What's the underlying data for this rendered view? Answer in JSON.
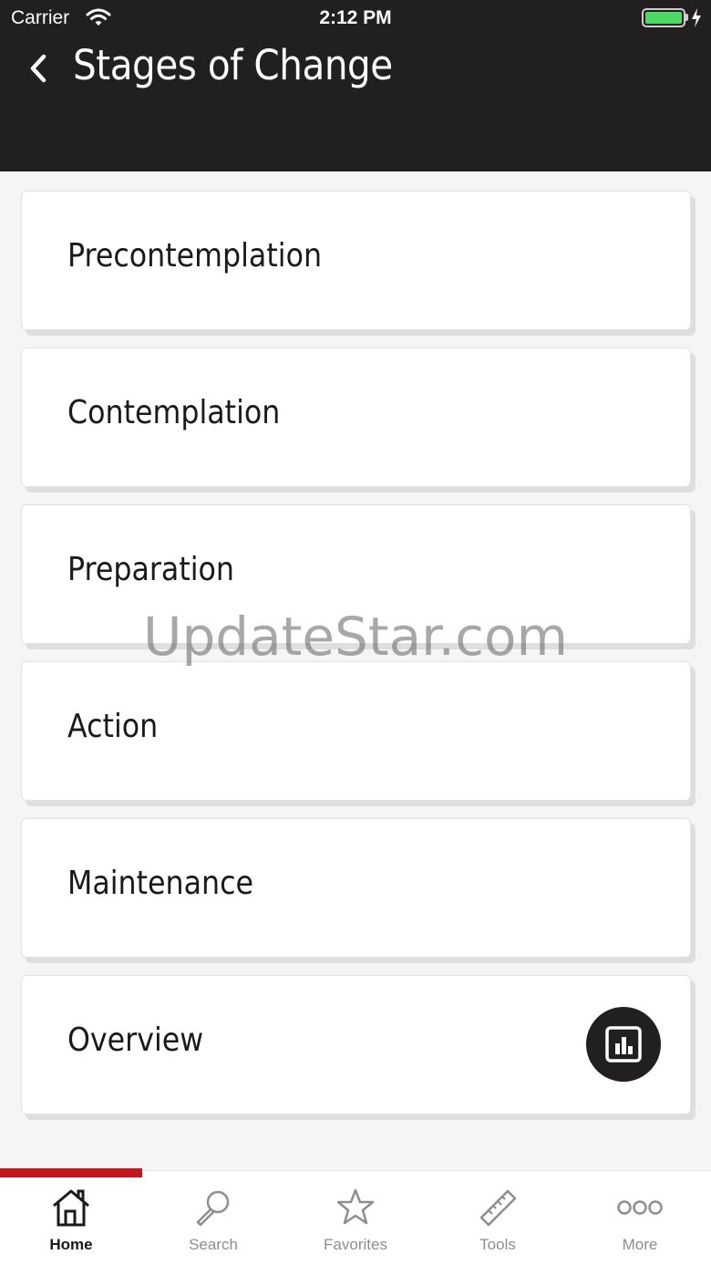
{
  "status_bar": {
    "carrier": "Carrier",
    "time": "2:12 PM"
  },
  "header": {
    "title": "Stages of Change"
  },
  "cards": [
    {
      "label": "Precontemplation"
    },
    {
      "label": "Contemplation"
    },
    {
      "label": "Preparation"
    },
    {
      "label": "Action"
    },
    {
      "label": "Maintenance"
    },
    {
      "label": "Overview",
      "icon": "bar-chart-icon"
    }
  ],
  "watermark": "UpdateStar.com",
  "tabs": [
    {
      "label": "Home",
      "icon": "home-icon",
      "active": true
    },
    {
      "label": "Search",
      "icon": "search-icon"
    },
    {
      "label": "Favorites",
      "icon": "star-icon"
    },
    {
      "label": "Tools",
      "icon": "ruler-icon"
    },
    {
      "label": "More",
      "icon": "more-icon"
    }
  ],
  "colors": {
    "header_bg": "#221f20",
    "accent": "#c4161c",
    "battery": "#4cd964",
    "background": "#f5f5f5"
  }
}
